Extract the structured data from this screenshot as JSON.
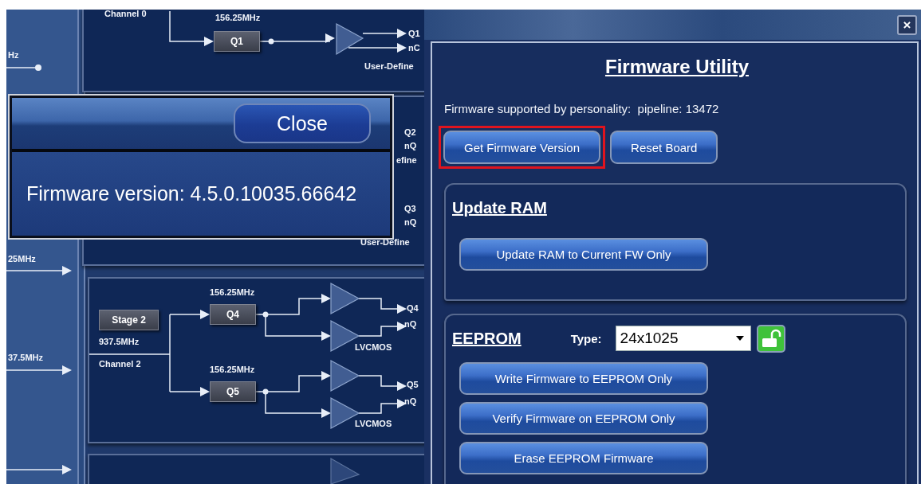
{
  "schematic": {
    "items": [
      {
        "kind": "label",
        "text": "Channel 0"
      },
      {
        "kind": "label",
        "text": "156.25MHz"
      },
      {
        "kind": "block",
        "text": "Q1"
      },
      {
        "kind": "label",
        "text": "Q1"
      },
      {
        "kind": "label",
        "text": "nC"
      },
      {
        "kind": "label",
        "text": "User-Define"
      },
      {
        "kind": "label",
        "text": "Hz"
      },
      {
        "kind": "label",
        "text": "Q2"
      },
      {
        "kind": "label",
        "text": "nQ"
      },
      {
        "kind": "label",
        "text": "efine"
      },
      {
        "kind": "label",
        "text": "Q3"
      },
      {
        "kind": "label",
        "text": "nQ"
      },
      {
        "kind": "label",
        "text": "User-Define"
      },
      {
        "kind": "label",
        "text": "25MHz"
      },
      {
        "kind": "label",
        "text": "156.25MHz"
      },
      {
        "kind": "block",
        "text": "Stage 2"
      },
      {
        "kind": "block",
        "text": "Q4"
      },
      {
        "kind": "label",
        "text": "Q4"
      },
      {
        "kind": "label",
        "text": "nQ"
      },
      {
        "kind": "label",
        "text": "937.5MHz"
      },
      {
        "kind": "label",
        "text": "LVCMOS"
      },
      {
        "kind": "label",
        "text": "37.5MHz"
      },
      {
        "kind": "label",
        "text": "Channel 2"
      },
      {
        "kind": "label",
        "text": "156.25MHz"
      },
      {
        "kind": "block",
        "text": "Q5"
      },
      {
        "kind": "label",
        "text": "Q5"
      },
      {
        "kind": "label",
        "text": "nQ"
      },
      {
        "kind": "label",
        "text": "LVCMOS"
      }
    ]
  },
  "version_dialog": {
    "close_button": "Close",
    "message": "Firmware version: 4.5.0.10035.66642"
  },
  "firmware_utility": {
    "close_button": "×",
    "title": "Firmware Utility",
    "supported_text": "Firmware supported by personality:  pipeline: 13472",
    "buttons": [
      {
        "label": "Get Firmware Version",
        "highlighted": true
      },
      {
        "label": "Reset Board",
        "highlighted": false
      }
    ],
    "update_ram": {
      "heading": "Update RAM",
      "buttons": [
        "Update RAM to Current FW Only"
      ]
    },
    "eeprom": {
      "heading": "EEPROM",
      "type_label": "Type:",
      "type_value": "24x1025",
      "locked": false,
      "buttons": [
        "Write Firmware to EEPROM Only",
        "Verify Firmware on EEPROM Only",
        "Erase EEPROM Firmware"
      ]
    }
  }
}
